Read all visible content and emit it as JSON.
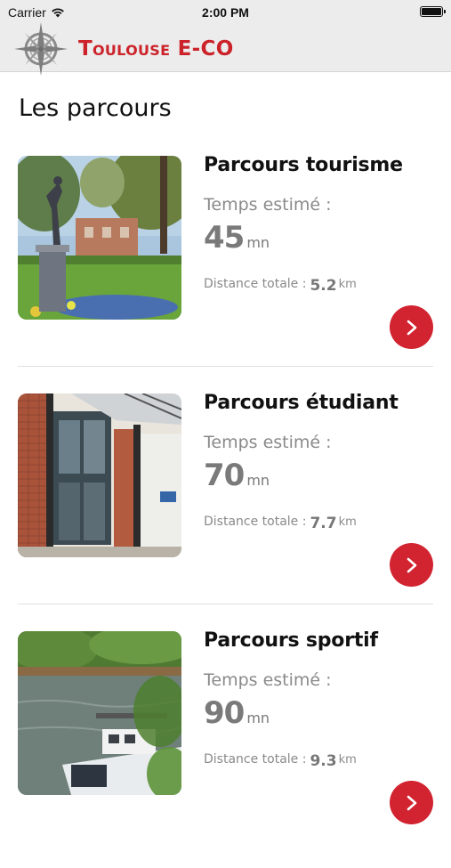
{
  "status_bar": {
    "carrier": "Carrier",
    "time": "2:00 PM"
  },
  "header": {
    "logo_text_main": "Toulouse E-CO",
    "brand_color": "#cc2229"
  },
  "page": {
    "title": "Les parcours"
  },
  "parcours": [
    {
      "title": "Parcours tourisme",
      "time_label": "Temps estimé :",
      "time_value": "45",
      "time_unit": "mn",
      "distance_label": "Distance totale :",
      "distance_value": "5.2",
      "distance_unit": "km",
      "image": "park-statue-photo"
    },
    {
      "title": "Parcours étudiant",
      "time_label": "Temps estimé :",
      "time_value": "70",
      "time_unit": "mn",
      "distance_label": "Distance totale :",
      "distance_value": "7.7",
      "distance_unit": "km",
      "image": "building-entrance-photo"
    },
    {
      "title": "Parcours sportif",
      "time_label": "Temps estimé :",
      "time_value": "90",
      "time_unit": "mn",
      "distance_label": "Distance totale :",
      "distance_value": "9.3",
      "distance_unit": "km",
      "image": "river-boat-photo"
    }
  ],
  "icons": {
    "wifi": "wifi-icon",
    "battery": "battery-icon",
    "compass": "compass-rose-icon",
    "go": "chevron-right-icon"
  },
  "accent_button_color": "#d12330"
}
